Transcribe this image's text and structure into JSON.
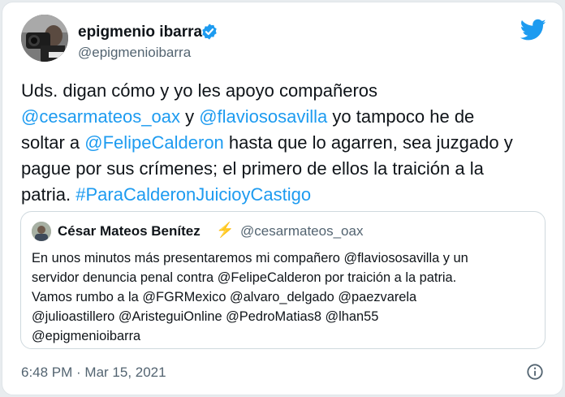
{
  "author": {
    "name": "epigmenio ibarra",
    "handle": "@epigmenioibarra",
    "avatar_icon": "profile-photo"
  },
  "icons": {
    "verified": "verified-badge-icon",
    "platform": "twitter-bird-icon",
    "info": "info-icon"
  },
  "colors": {
    "link": "#1d9bf0",
    "secondary_text": "#536471",
    "verified": "#1d9bf0",
    "bolt": "#f5a623"
  },
  "tweet": {
    "lines": [
      [
        {
          "text": "Uds. digan cómo y yo les apoyo compañeros",
          "link": false
        }
      ],
      [
        {
          "text": "@cesarmateos_oax",
          "link": true
        },
        {
          "text": " y ",
          "link": false
        },
        {
          "text": "@flaviososavilla",
          "link": true
        },
        {
          "text": " yo tampoco he de",
          "link": false
        }
      ],
      [
        {
          "text": "soltar a ",
          "link": false
        },
        {
          "text": "@FelipeCalderon",
          "link": true
        },
        {
          "text": " hasta que lo agarren, sea juzgado y",
          "link": false
        }
      ],
      [
        {
          "text": "pague por sus crímenes; el primero de ellos la traición a la",
          "link": false
        }
      ],
      [
        {
          "text": "patria. ",
          "link": false
        },
        {
          "text": "#ParaCalderonJuicioyCastigo",
          "link": true
        }
      ]
    ]
  },
  "quoted": {
    "name": "César Mateos Benítez",
    "emoji": "⚡",
    "handle": "@cesarmateos_oax",
    "lines": [
      "En unos minutos más presentaremos mi compañero @flaviososavilla y un",
      "servidor denuncia penal contra @FelipeCalderon por traición a la patria.",
      "Vamos rumbo a la @FGRMexico @alvaro_delgado @paezvarela",
      "@julioastillero @AristeguiOnline @PedroMatias8 @lhan55",
      "@epigmenioibarra"
    ]
  },
  "timestamp": "6:48 PM · Mar 15, 2021"
}
